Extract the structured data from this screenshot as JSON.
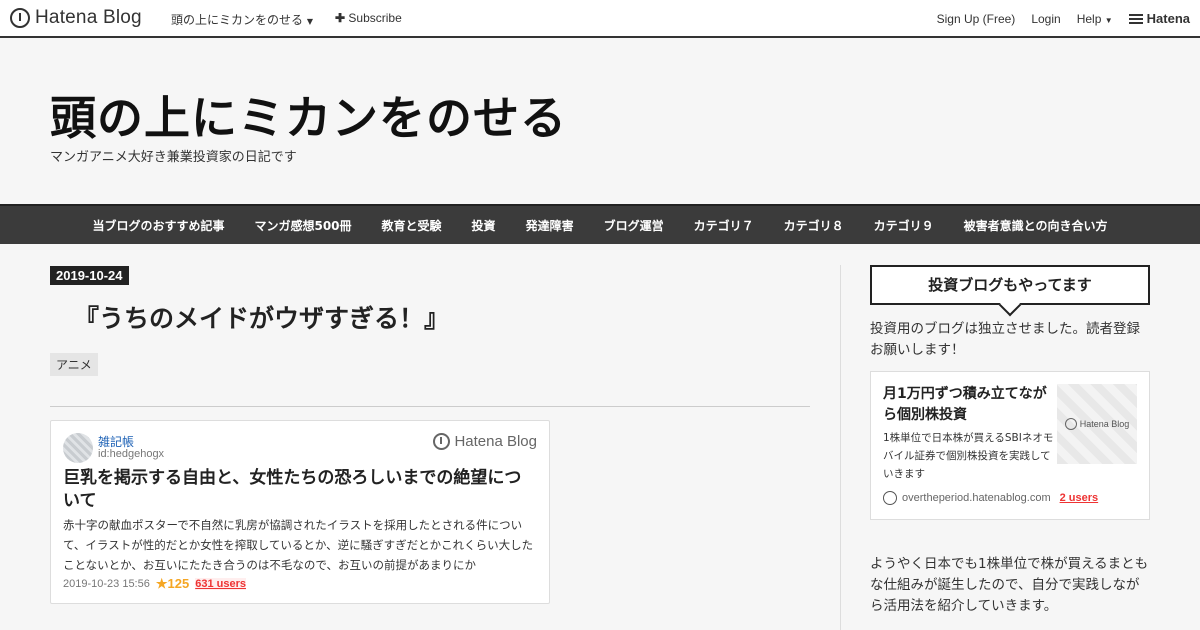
{
  "topbar": {
    "logo_text": "Hatena Blog",
    "blog_select": "頭の上にミカンをのせる",
    "subscribe": "Subscribe",
    "signup": "Sign Up (Free)",
    "login": "Login",
    "help": "Help",
    "hatena": "Hatena"
  },
  "header": {
    "title": "頭の上にミカンをのせる",
    "description": "マンガアニメ大好き兼業投資家の日記です"
  },
  "nav": {
    "items": [
      "当ブログのおすすめ記事",
      "マンガ感想500冊",
      "教育と受験",
      "投資",
      "発達障害",
      "ブログ運営",
      "カテゴリ７",
      "カテゴリ８",
      "カテゴリ９",
      "被害者意識との向き合い方"
    ]
  },
  "entry": {
    "date": "2019-10-24",
    "title": "『うちのメイドがウザすぎる！』",
    "category": "アニメ"
  },
  "embed": {
    "blog_name": "雑記帳",
    "user_id": "id:hedgehogx",
    "brand": "Hatena Blog",
    "title": "巨乳を掲示する自由と、女性たちの恐ろしいまでの絶望について",
    "excerpt": "赤十字の献血ポスターで不自然に乳房が協調されたイラストを採用したとされる件について、イラストが性的だとか女性を搾取しているとか、逆に騒ぎすぎだとかこれくらい大したことないとか、お互いにたたき合うのは不毛なので、お互いの前提があまりにか",
    "datetime": "2019-10-23 15:56",
    "stars": "125",
    "users": "631 users"
  },
  "sidebar": {
    "heading": "投資ブログもやってます",
    "intro": "投資用のブログは独立させました。読者登録お願いします！",
    "card": {
      "title": "月1万円ずつ積み立てながら個別株投資",
      "description": "1株単位で日本株が買えるSBIネオモバイル証券で個別株投資を実践していきます",
      "thumb_label": "Hatena Blog",
      "domain": "overtheperiod.hatenablog.com",
      "users": "2 users"
    },
    "text2": "ようやく日本でも1株単位で株が買えるまともな仕組みが誕生したので、自分で実践しながら活用法を紹介していきます。"
  }
}
